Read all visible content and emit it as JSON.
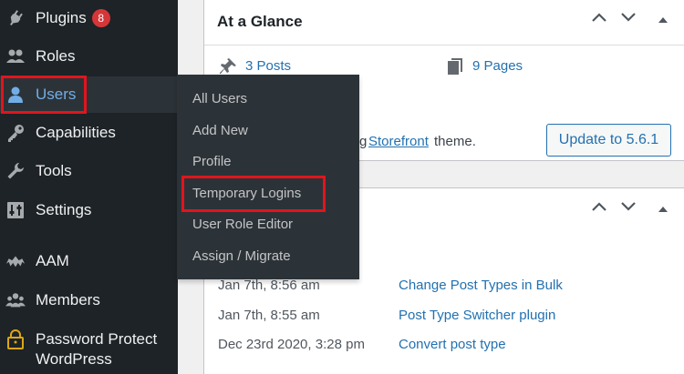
{
  "sidebar": {
    "items": [
      {
        "label": "Plugins",
        "badge": "8",
        "icon": "plugins-icon"
      },
      {
        "label": "Roles",
        "icon": "roles-icon"
      },
      {
        "label": "Users",
        "icon": "users-icon",
        "active": true
      },
      {
        "label": "Capabilities",
        "icon": "key-icon"
      },
      {
        "label": "Tools",
        "icon": "wrench-icon"
      },
      {
        "label": "Settings",
        "icon": "settings-icon"
      },
      {
        "label": "AAM",
        "icon": "aam-icon"
      },
      {
        "label": "Members",
        "icon": "members-icon"
      },
      {
        "label": "Password Protect\nWordPress",
        "icon": "lock-icon"
      }
    ]
  },
  "users_submenu": {
    "items": [
      "All Users",
      "Add New",
      "Profile",
      "Temporary Logins",
      "User Role Editor",
      "Assign / Migrate"
    ]
  },
  "at_a_glance": {
    "title": "At a Glance",
    "posts": "3 Posts",
    "pages": "9 Pages",
    "theme_prefix": "g",
    "theme_link": "Storefront",
    "theme_suffix": " theme.",
    "update_button": "Update to 5.6.1"
  },
  "activity": {
    "rows": [
      {
        "date": "Jan 7th, 8:56 am",
        "title": "Change Post Types in Bulk"
      },
      {
        "date": "Jan 7th, 8:55 am",
        "title": "Post Type Switcher plugin"
      },
      {
        "date": "Dec 23rd 2020, 3:28 pm",
        "title": "Convert post type"
      }
    ]
  },
  "colors": {
    "sidebar_bg": "#1d2327",
    "submenu_bg": "#2c3338",
    "link": "#2271b1",
    "highlight": "#e2141d",
    "badge": "#d63638"
  }
}
